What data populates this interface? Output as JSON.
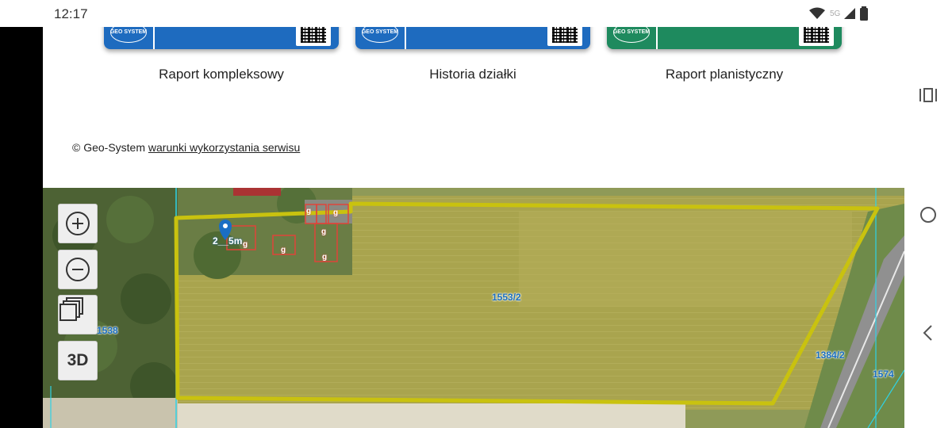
{
  "status_bar": {
    "time": "12:17",
    "network": "5G"
  },
  "report_cards": [
    {
      "label": "Raport kompleksowy",
      "logo_text": "GEO SYSTEM",
      "color": "#1e6bbf"
    },
    {
      "label": "Historia działki",
      "logo_text": "GEO SYSTEM",
      "color": "#1e6bbf"
    },
    {
      "label": "Raport planistyczny",
      "logo_text": "GEO SYSTEM",
      "color": "#1e8a5e"
    }
  ],
  "footer": {
    "copyright": "© Geo-System",
    "terms_link": "warunki wykorzystania serwisu"
  },
  "map": {
    "controls": {
      "three_d": "3D"
    },
    "parcel_labels": [
      "1553/2",
      "1538",
      "1384/2",
      "1574"
    ],
    "building_labels": [
      "g",
      "g",
      "g",
      "g",
      "g",
      "g"
    ],
    "pin_label": "2__5m"
  },
  "nav": {
    "recent": "recents-icon",
    "home": "home-icon",
    "back": "back-icon"
  }
}
